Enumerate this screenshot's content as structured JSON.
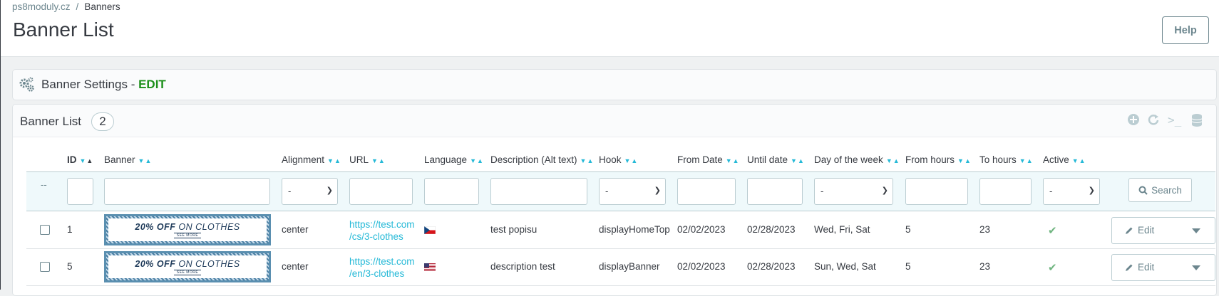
{
  "breadcrumb": {
    "root": "ps8moduly.cz",
    "separator": "/",
    "current": "Banners"
  },
  "page_title": "Banner List",
  "help_label": "Help",
  "settings": {
    "title": "Banner Settings - ",
    "edit_label": "EDIT",
    "icon": "gears-icon"
  },
  "list": {
    "title": "Banner List",
    "count": "2",
    "tools": [
      "add-icon",
      "refresh-icon",
      "terminal-icon",
      "database-icon"
    ]
  },
  "columns": [
    "ID",
    "Banner",
    "Alignment",
    "URL",
    "Language",
    "Description (Alt text)",
    "Hook",
    "From Date",
    "Until date",
    "Day of the week",
    "From hours",
    "To hours",
    "Active"
  ],
  "filters": {
    "dash": "--",
    "select_default": "-",
    "search_label": "Search"
  },
  "banner_image": {
    "main_bold": "20% OFF",
    "main_light": "ON CLOTHES",
    "sub": "SEE MORE"
  },
  "rows": [
    {
      "id": "1",
      "alignment": "center",
      "url_line1": "https://test.com",
      "url_line2": "/cs/3-clothes",
      "language_flag": "czech-flag",
      "description": "test popisu",
      "hook": "displayHomeTop",
      "from_date": "02/02/2023",
      "until_date": "02/28/2023",
      "days": "Wed, Fri, Sat",
      "from_hours": "5",
      "to_hours": "23",
      "active": "check-icon",
      "action": "Edit"
    },
    {
      "id": "5",
      "alignment": "center",
      "url_line1": "https://test.com",
      "url_line2": "/en/3-clothes",
      "language_flag": "us-flag",
      "description": "description test",
      "hook": "displayBanner",
      "from_date": "02/02/2023",
      "until_date": "02/28/2023",
      "days": "Sun, Wed, Sat",
      "from_hours": "5",
      "to_hours": "23",
      "active": "check-icon",
      "action": "Edit"
    }
  ],
  "colors": {
    "accent": "#25b9d7",
    "edit_green": "#1c8f1a",
    "active_green": "#70b580",
    "text": "#363a41"
  }
}
